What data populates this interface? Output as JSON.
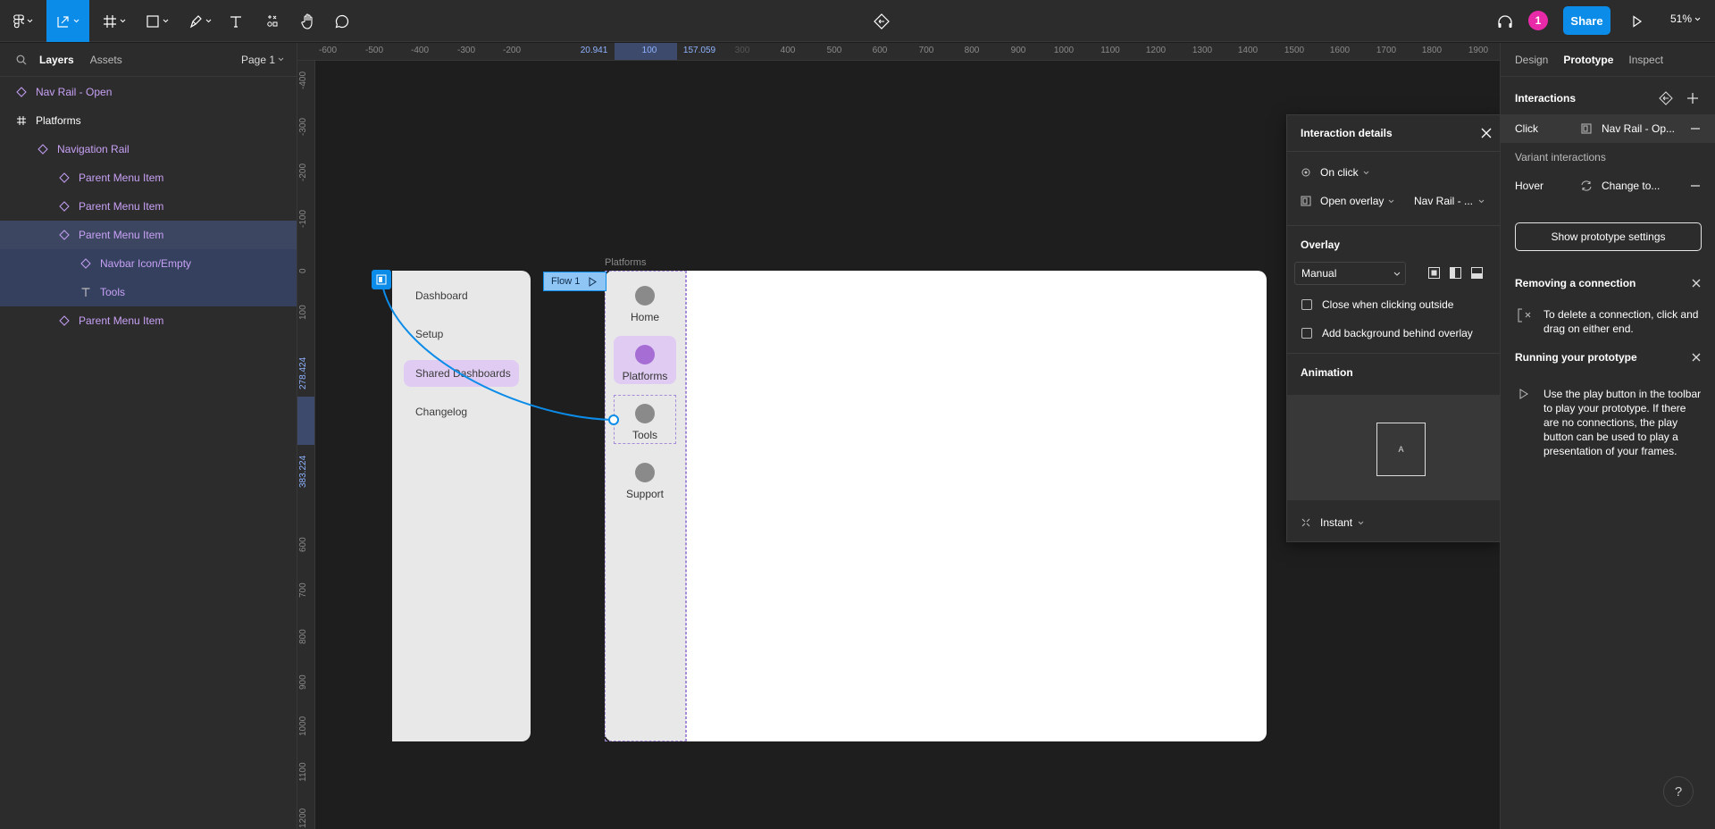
{
  "toolbar": {
    "share_label": "Share",
    "zoom_label": "51%",
    "avatar_initial": "1",
    "accent": "#0c8ce9",
    "avatar_color": "#e82aa8"
  },
  "left_panel": {
    "tabs": [
      "Layers",
      "Assets"
    ],
    "page_label": "Page 1",
    "layers": [
      {
        "label": "Nav Rail - Open",
        "icon": "component-icon"
      },
      {
        "label": "Platforms",
        "icon": "frame-icon"
      },
      {
        "label": "Navigation Rail",
        "icon": "component-icon"
      },
      {
        "label": "Parent Menu Item",
        "icon": "component-icon"
      },
      {
        "label": "Parent Menu Item",
        "icon": "component-icon"
      },
      {
        "label": "Parent Menu Item",
        "icon": "component-icon"
      },
      {
        "label": "Navbar Icon/Empty",
        "icon": "component-icon"
      },
      {
        "label": "Tools",
        "icon": "text-icon"
      },
      {
        "label": "Parent Menu Item",
        "icon": "component-icon"
      }
    ]
  },
  "rulers": {
    "h_ticks": [
      "-600",
      "-500",
      "-400",
      "-300",
      "-200",
      "20.941",
      "100",
      "157.059",
      "300",
      "400",
      "500",
      "600",
      "700",
      "800",
      "900",
      "1000",
      "1100",
      "1200",
      "1300",
      "1400",
      "1500",
      "1600",
      "1700",
      "1800",
      "1900"
    ],
    "v_ticks": [
      "-400",
      "-300",
      "-200",
      "-100",
      "0",
      "100",
      "278.424",
      "383.224",
      "600",
      "700",
      "800",
      "900",
      "1000",
      "1100",
      "1200"
    ]
  },
  "canvas": {
    "platforms_label": "Platforms",
    "flow_label": "Flow 1",
    "nav_open_items": [
      "Dashboard",
      "Setup",
      "Shared Dashboards",
      "Changelog"
    ],
    "rail_items": [
      "Home",
      "Platforms",
      "Tools",
      "Support"
    ]
  },
  "details": {
    "title": "Interaction details",
    "trigger": "On click",
    "action": "Open overlay",
    "destination": "Nav Rail - ...",
    "overlay_heading": "Overlay",
    "overlay_position": "Manual",
    "close_outside": "Close when clicking outside",
    "add_background": "Add background behind overlay",
    "animation_heading": "Animation",
    "preview_letter": "A",
    "animation_type": "Instant"
  },
  "right_panel": {
    "tabs": [
      "Design",
      "Prototype",
      "Inspect"
    ],
    "interactions_heading": "Interactions",
    "click_label": "Click",
    "click_target": "Nav Rail - Op...",
    "variant_heading": "Variant interactions",
    "hover_label": "Hover",
    "hover_target": "Change to...",
    "settings_button": "Show prototype settings",
    "removing_heading": "Removing a connection",
    "removing_text": "To delete a connection, click and drag on either end.",
    "running_heading": "Running your prototype",
    "running_text": "Use the play button in the toolbar to play your prototype. If there are no connections, the play button can be used to play a presentation of your frames.",
    "help_label": "?"
  }
}
